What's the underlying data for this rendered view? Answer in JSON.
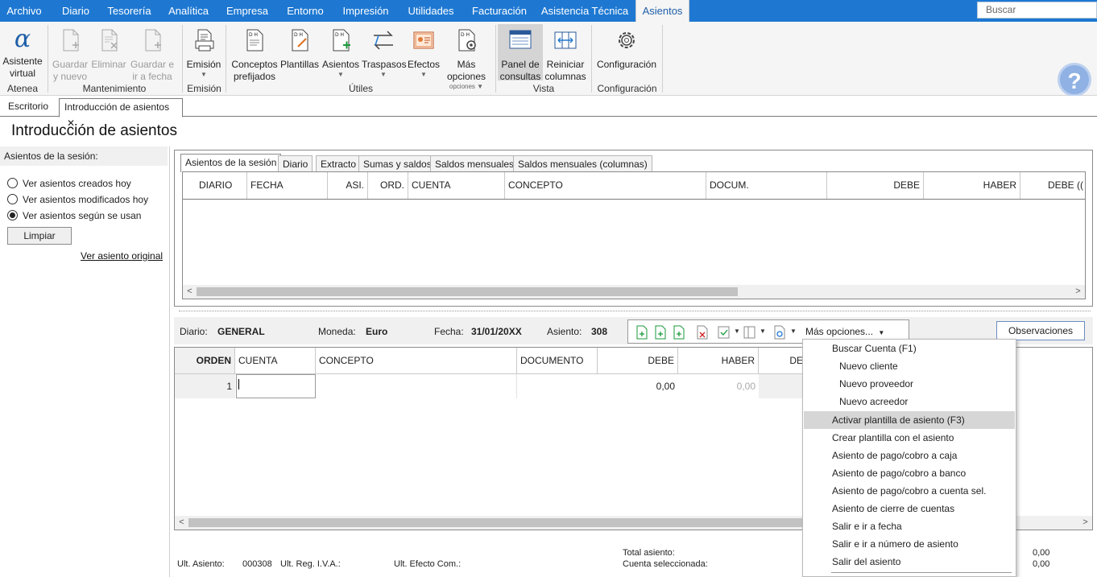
{
  "menu": {
    "items": [
      "Archivo",
      "Diario",
      "Tesorería",
      "Analítica",
      "Empresa",
      "Entorno",
      "Impresión",
      "Utilidades",
      "Facturación",
      "Asistencia Técnica",
      "Asientos"
    ],
    "active": "Asientos",
    "search_placeholder": "Buscar"
  },
  "ribbon": {
    "asistente": "Asistente virtual",
    "guardar_nuevo": "Guardar y nuevo",
    "eliminar": "Eliminar",
    "guardar_fecha": "Guardar e ir a fecha",
    "emision": "Emisión",
    "conceptos": "Conceptos prefijados",
    "plantillas": "Plantillas",
    "asientos": "Asientos",
    "traspasos": "Traspasos",
    "efectos": "Efectos",
    "mas_opciones": "Más opciones",
    "panel": "Panel de consultas",
    "reiniciar": "Reiniciar columnas",
    "configuracion": "Configuración",
    "groups": {
      "atenea": "Atenea",
      "mantenimiento": "Mantenimiento",
      "emision": "Emisión",
      "utiles": "Útiles",
      "vista": "Vista",
      "configuracion": "Configuración"
    }
  },
  "doctabs": {
    "escritorio": "Escritorio",
    "introduccion": "Introducción de asientos",
    "close": "✕"
  },
  "page": {
    "title": "Introducción de asientos"
  },
  "left": {
    "header": "Asientos de la sesión:",
    "options": [
      "Ver asientos creados hoy",
      "Ver asientos modificados hoy",
      "Ver asientos según se usan"
    ],
    "selected": 2,
    "limpiar": "Limpiar",
    "ver_original": "Ver asiento original"
  },
  "session_tabs": [
    "Asientos de la sesión",
    "Diario",
    "Extracto",
    "Sumas y saldos",
    "Saldos mensuales",
    "Saldos mensuales (columnas)"
  ],
  "session_grid": {
    "columns": [
      "DIARIO",
      "FECHA",
      "ASI.",
      "ORD.",
      "CUENTA",
      "CONCEPTO",
      "DOCUM.",
      "DEBE",
      "HABER",
      "DEBE (("
    ]
  },
  "info": {
    "diario_label": "Diario:",
    "diario": "GENERAL",
    "moneda_label": "Moneda:",
    "moneda": "Euro",
    "fecha_label": "Fecha:",
    "fecha": "31/01/20XX",
    "asiento_label": "Asiento:",
    "asiento": "308",
    "mas_opciones": "Más opciones...",
    "observaciones": "Observaciones"
  },
  "entry_grid": {
    "columns": [
      "ORDEN",
      "CUENTA",
      "CONCEPTO",
      "DOCUMENTO",
      "DEBE",
      "HABER",
      "DE"
    ],
    "row": {
      "orden": "1",
      "cuenta": "",
      "concepto": "",
      "documento": "",
      "debe": "0,00",
      "haber": "0,00"
    }
  },
  "footer": {
    "ult_asiento_label": "Ult. Asiento:",
    "ult_asiento": "000308",
    "ult_iva_label": "Ult. Reg. I.V.A.:",
    "ult_efecto_label": "Ult. Efecto Com.:",
    "total_label": "Total asiento:",
    "cuenta_label": "Cuenta seleccionada:",
    "total_val": "0,00",
    "cuenta_val": "0,00"
  },
  "dropdown": {
    "items": [
      {
        "label": "Buscar Cuenta (F1)",
        "indent": false
      },
      {
        "label": "Nuevo cliente",
        "indent": true
      },
      {
        "label": "Nuevo proveedor",
        "indent": true
      },
      {
        "label": "Nuevo acreedor",
        "indent": true
      },
      {
        "label": "Activar plantilla de asiento (F3)",
        "indent": false
      },
      {
        "label": "Crear plantilla con el asiento",
        "indent": false
      },
      {
        "label": "Asiento de pago/cobro a caja",
        "indent": false
      },
      {
        "label": "Asiento de pago/cobro a banco",
        "indent": false
      },
      {
        "label": "Asiento de pago/cobro a cuenta sel.",
        "indent": false
      },
      {
        "label": "Asiento de cierre de cuentas",
        "indent": false
      },
      {
        "label": "Salir e ir a fecha",
        "indent": false
      },
      {
        "label": "Salir e ir a número de asiento",
        "indent": false
      },
      {
        "label": "Salir del asiento",
        "indent": false
      }
    ],
    "highlighted": 4
  },
  "colors": {
    "menubar": "#1e78d2",
    "ribbon": "#f5f5f5",
    "highlight": "#d6d6d6"
  }
}
